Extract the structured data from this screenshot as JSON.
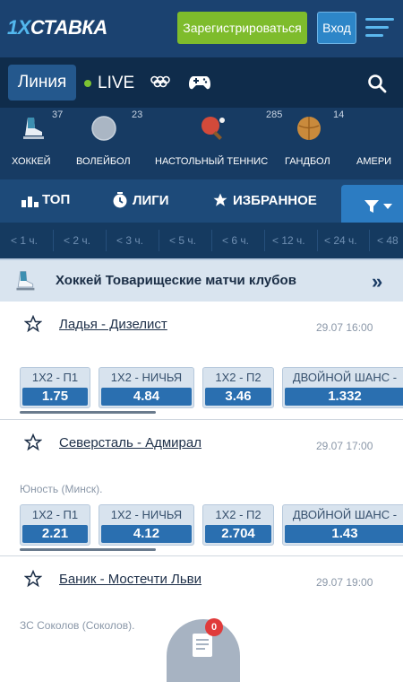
{
  "header": {
    "logo_a": "1X",
    "logo_b": "СТАВКА",
    "register": "Зарегистрироваться",
    "login": "Вход"
  },
  "nav": {
    "line": "Линия",
    "live": "LIVE",
    "icons": [
      "olympic-rings-icon",
      "gamepad-icon",
      "search-icon"
    ]
  },
  "sports": [
    {
      "label": "ХОККЕЙ",
      "count": "37",
      "icon": "hockey-skate-icon"
    },
    {
      "label": "ВОЛЕЙБОЛ",
      "count": "23",
      "icon": "volleyball-icon"
    },
    {
      "label": "НАСТОЛЬНЫЙ ТЕННИС",
      "count": "285",
      "icon": "table-tennis-icon"
    },
    {
      "label": "ГАНДБОЛ",
      "count": "14",
      "icon": "handball-icon"
    },
    {
      "label": "АМЕРИ",
      "count": "",
      "icon": ""
    }
  ],
  "tabs": {
    "top": "ТОП",
    "leagues": "ЛИГИ",
    "favorites": "ИЗБРАННОЕ"
  },
  "times": [
    "< 1 ч.",
    "< 2 ч.",
    "< 3 ч.",
    "< 5 ч.",
    "< 6 ч.",
    "< 12 ч.",
    "< 24 ч.",
    "< 48"
  ],
  "league": {
    "title": "Хоккей Товарищеские матчи клубов"
  },
  "matches": [
    {
      "teams": "Ладья - Дизелист",
      "date": "29.07 16:00",
      "sub": "",
      "odds": [
        {
          "label": "1X2 - П1",
          "value": "1.75"
        },
        {
          "label": "1X2 - НИЧЬЯ",
          "value": "4.84"
        },
        {
          "label": "1X2 - П2",
          "value": "3.46"
        },
        {
          "label": "ДВОЙНОЙ ШАНС -",
          "value": "1.332"
        }
      ]
    },
    {
      "teams": "Северсталь - Адмирал",
      "date": "29.07 17:00",
      "sub": "Юность (Минск).",
      "odds": [
        {
          "label": "1X2 - П1",
          "value": "2.21"
        },
        {
          "label": "1X2 - НИЧЬЯ",
          "value": "4.12"
        },
        {
          "label": "1X2 - П2",
          "value": "2.704"
        },
        {
          "label": "ДВОЙНОЙ ШАНС -",
          "value": "1.43"
        }
      ]
    },
    {
      "teams": "Баник - Мостечти Льви",
      "date": "29.07 19:00",
      "sub": "ЗС Соколов (Соколов).",
      "odds": []
    }
  ],
  "coupon": {
    "count": "0"
  }
}
